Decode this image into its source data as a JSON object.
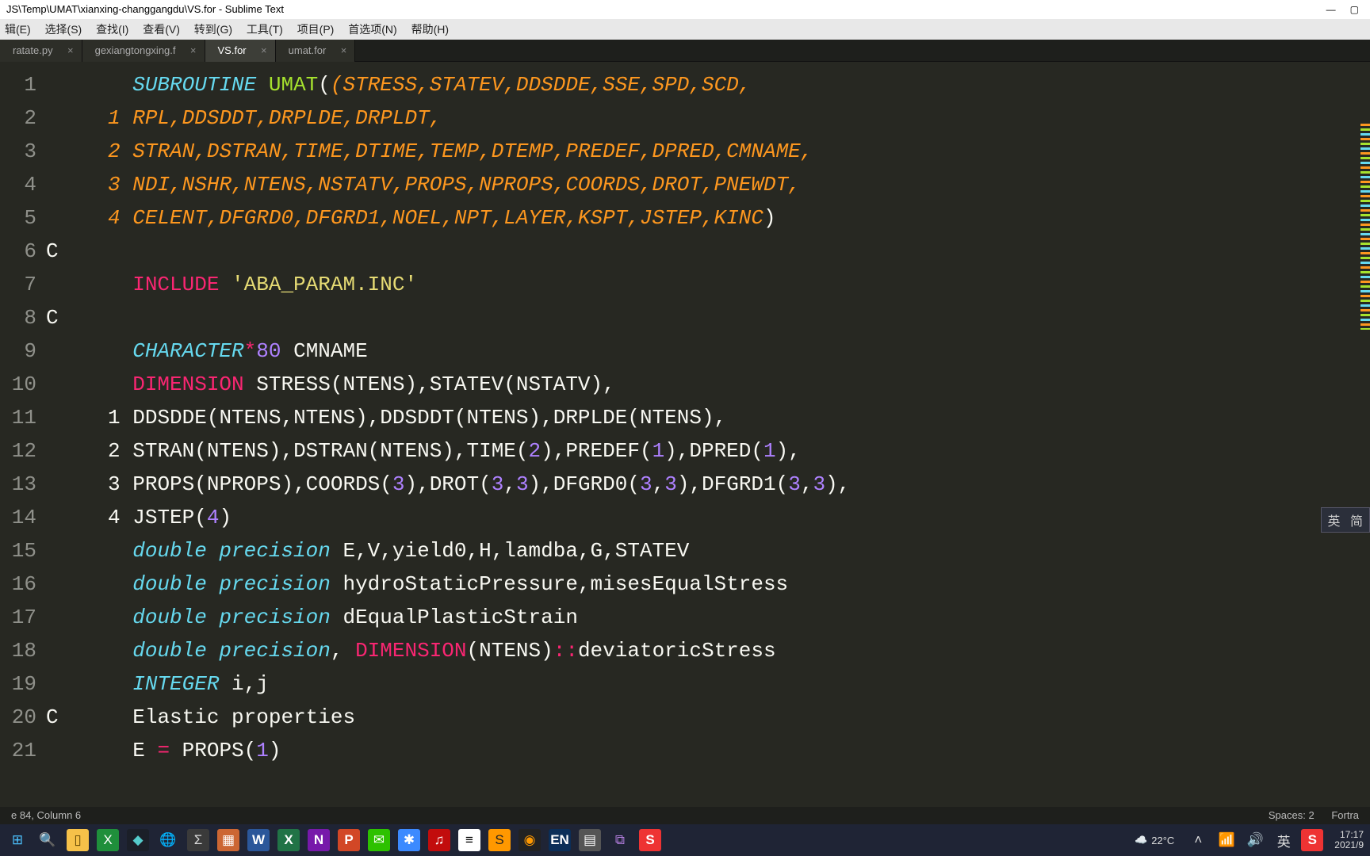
{
  "window": {
    "title": "JS\\Temp\\UMAT\\xianxing-changgangdu\\VS.for - Sublime Text",
    "min": "—",
    "max": "▢"
  },
  "menu": {
    "items": [
      "辑(E)",
      "选择(S)",
      "查找(I)",
      "查看(V)",
      "转到(G)",
      "工具(T)",
      "项目(P)",
      "首选项(N)",
      "帮助(H)"
    ]
  },
  "tabs": [
    {
      "label": "ratate.py",
      "active": false
    },
    {
      "label": "gexiangtongxing.f",
      "active": false
    },
    {
      "label": "VS.for",
      "active": true
    },
    {
      "label": "umat.for",
      "active": false
    }
  ],
  "status": {
    "left": "e 84, Column 6",
    "spaces": "Spaces: 2",
    "lang": "Fortra"
  },
  "side_pill": {
    "a": "英",
    "b": "简"
  },
  "taskbar": {
    "weather_temp": "22°C",
    "time": "17:17",
    "date": "2021/9",
    "ime": "英"
  },
  "code": {
    "l1": {
      "a": "SUBROUTINE",
      "b": "UMAT",
      "p": "(STRESS,STATEV,DDSDDE,SSE,SPD,SCD,"
    },
    "l2": {
      "n": "1",
      "p": "RPL,DDSDDT,DRPLDE,DRPLDT,"
    },
    "l3": {
      "n": "2",
      "p": "STRAN,DSTRAN,TIME,DTIME,TEMP,DTEMP,PREDEF,DPRED,CMNAME,"
    },
    "l4": {
      "n": "3",
      "p": "NDI,NSHR,NTENS,NSTATV,PROPS,NPROPS,COORDS,DROT,PNEWDT,"
    },
    "l5": {
      "n": "4",
      "p": "CELENT,DFGRD0,DFGRD1,NOEL,NPT,LAYER,KSPT,JSTEP,KINC"
    },
    "l7": {
      "kw": "INCLUDE",
      "s": "'ABA_PARAM.INC'"
    },
    "l9": {
      "kw": "CHARACTER",
      "op": "*",
      "n": "80",
      "t": "CMNAME"
    },
    "l10": {
      "kw": "DIMENSION",
      "t": "STRESS(NTENS),STATEV(NSTATV),"
    },
    "l11": {
      "n": "1",
      "t": "DDSDDE(NTENS,NTENS),DDSDDT(NTENS),DRPLDE(NTENS),"
    },
    "l12": {
      "n": "2",
      "a": "STRAN(NTENS),DSTRAN(NTENS),TIME(",
      "n2": "2",
      "b": "),PREDEF(",
      "n3": "1",
      "c": "),DPRED(",
      "n4": "1",
      "d": "),"
    },
    "l13": {
      "n": "3",
      "a": "PROPS(NPROPS),COORDS(",
      "n2": "3",
      "b": "),DROT(",
      "n3": "3",
      "c": ",",
      "n4": "3",
      "d": "),DFGRD0(",
      "n5": "3",
      "e": ",",
      "n6": "3",
      "f": "),DFGRD1(",
      "n7": "3",
      "g": ",",
      "n8": "3",
      "h": "),"
    },
    "l14": {
      "n": "4",
      "a": "JSTEP(",
      "n2": "4",
      "b": ")"
    },
    "l15": {
      "kw": "double precision",
      "t": "E,V,yield0,H,lamdba,G,STATEV"
    },
    "l16": {
      "kw": "double precision",
      "t": "hydroStaticPressure,misesEqualStress"
    },
    "l17": {
      "kw": "double precision",
      "t": "dEqualPlasticStrain"
    },
    "l18": {
      "kw": "double precision",
      "dm": "DIMENSION",
      "t1": "(NTENS)",
      "op": "::",
      "t2": "deviatoricStress"
    },
    "l19": {
      "kw": "INTEGER",
      "t": "i,j"
    },
    "l20": {
      "t": "Elastic properties"
    },
    "l21": {
      "a": "E ",
      "op": "=",
      "b": " PROPS(",
      "n": "1",
      "c": ")"
    }
  }
}
